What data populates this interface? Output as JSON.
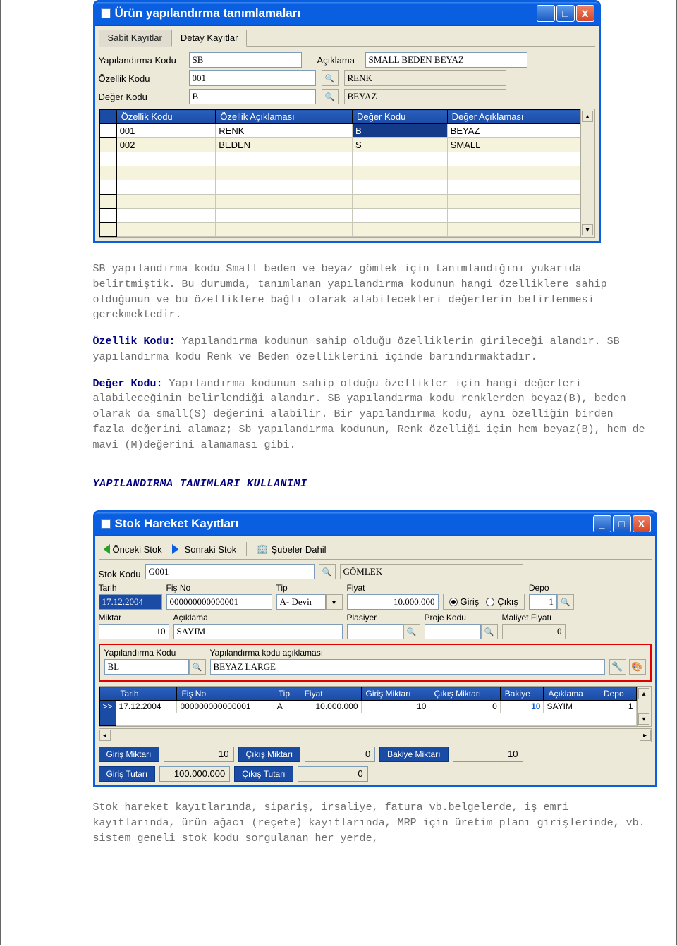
{
  "win1": {
    "title": "Ürün yapılandırma tanımlamaları",
    "tabs": {
      "t0": "Sabit Kayıtlar",
      "t1": "Detay Kayıtlar"
    },
    "labels": {
      "yapKodu": "Yapılandırma Kodu",
      "aciklama": "Açıklama",
      "ozellikKodu": "Özellik Kodu",
      "degerKodu": "Değer Kodu"
    },
    "fields": {
      "yapKodu": "SB",
      "aciklama": "SMALL BEDEN BEYAZ",
      "ozellikKodu": "001",
      "ozellikAd": "RENK",
      "degerKodu": "B",
      "degerAd": "BEYAZ"
    },
    "gridHeaders": {
      "h0": "Özellik Kodu",
      "h1": "Özellik Açıklaması",
      "h2": "Değer Kodu",
      "h3": "Değer Açıklaması"
    },
    "gridRows": {
      "r0": {
        "ind": ">>",
        "c0": "001",
        "c1": "RENK",
        "c2": "B",
        "c3": "BEYAZ"
      },
      "r1": {
        "ind": "",
        "c0": "002",
        "c1": "BEDEN",
        "c2": "S",
        "c3": "SMALL"
      }
    }
  },
  "doc": {
    "p1": "SB yapılandırma kodu Small beden ve beyaz gömlek için tanımlandığını yukarıda belirtmiştik. Bu durumda, tanımlanan yapılandırma kodunun hangi özelliklere sahip olduğunun ve bu özelliklere bağlı olarak alabilecekleri değerlerin belirlenmesi gerekmektedir.",
    "p2k": "Özellik Kodu:",
    "p2": " Yapılandırma kodunun sahip olduğu özelliklerin girileceği alandır. SB yapılandırma kodu Renk ve Beden özelliklerini içinde barındırmaktadır.",
    "p3k": "Değer Kodu:",
    "p3": " Yapılandırma kodunun sahip olduğu özellikler için hangi değerleri alabileceğinin belirlendiği alandır. SB yapılandırma kodu renklerden beyaz(B), beden olarak da small(S) değerini alabilir. Bir yapılandırma kodu, aynı özelliğin birden fazla değerini alamaz; Sb yapılandırma kodunun, Renk özelliği için hem beyaz(B), hem de mavi (M)değerini alamaması gibi.",
    "heading": "YAPILANDIRMA TANIMLARI KULLANIMI",
    "foot": "Stok hareket kayıtlarında, sipariş, irsaliye, fatura vb.belgelerde, iş emri kayıtlarında, ürün ağacı (reçete) kayıtlarında, MRP için üretim planı girişlerinde, vb. sistem geneli stok kodu sorgulanan her yerde,"
  },
  "win2": {
    "title": "Stok Hareket Kayıtları",
    "toolbar": {
      "prev": "Önceki Stok",
      "next": "Sonraki Stok",
      "subeler": "Şubeler Dahil"
    },
    "labels": {
      "stokKodu": "Stok Kodu",
      "stokAd": "GÖMLEK",
      "tarih": "Tarih",
      "fisNo": "Fiş No",
      "tip": "Tip",
      "fiyat": "Fiyat",
      "depo": "Depo",
      "miktar": "Miktar",
      "aciklama": "Açıklama",
      "plasiyer": "Plasiyer",
      "projeKodu": "Proje Kodu",
      "maliyet": "Maliyet Fiyatı",
      "yapKodu": "Yapılandırma Kodu",
      "yapKoduAck": "Yapılandırma kodu açıklaması",
      "giris": "Giriş",
      "cikis": "Çıkış"
    },
    "fields": {
      "stokKodu": "G001",
      "tarih": "17.12.2004",
      "fisNo": "000000000000001",
      "tip": "A- Devir",
      "fiyat": "10.000.000",
      "depo": "1",
      "miktar": "10",
      "aciklama": "SAYIM",
      "plasiyer": "",
      "projeKodu": "",
      "maliyet": "0",
      "yapKodu": "BL",
      "yapKoduAck": "BEYAZ LARGE"
    },
    "grid": {
      "h": {
        "h0": "Tarih",
        "h1": "Fiş No",
        "h2": "Tip",
        "h3": "Fiyat",
        "h4": "Giriş Miktarı",
        "h5": "Çıkış Miktarı",
        "h6": "Bakiye",
        "h7": "Açıklama",
        "h8": "Depo"
      },
      "r0": {
        "ind": ">>",
        "c0": "17.12.2004",
        "c1": "000000000000001",
        "c2": "A",
        "c3": "10.000.000",
        "c4": "10",
        "c5": "0",
        "c6": "10",
        "c7": "SAYIM",
        "c8": "1"
      }
    },
    "totals": {
      "gMikLbl": "Giriş Miktarı",
      "gMik": "10",
      "gTutLbl": "Giriş Tutarı",
      "gTut": "100.000.000",
      "cMikLbl": "Çıkış Miktarı",
      "cMik": "0",
      "cTutLbl": "Çıkış Tutarı",
      "cTut": "0",
      "bMikLbl": "Bakiye Miktarı",
      "bMik": "10"
    }
  }
}
